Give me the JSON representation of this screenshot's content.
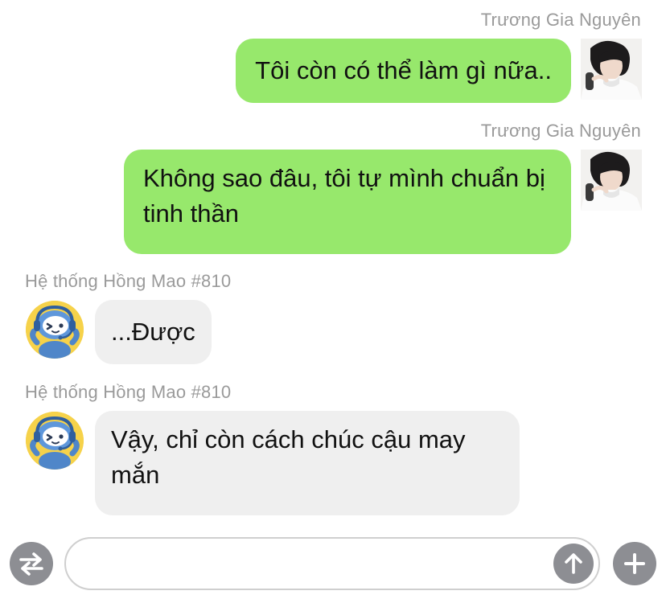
{
  "messages": [
    {
      "sender": "Trương Gia Nguyên",
      "text": "Tôi còn có thể làm gì nữa..",
      "direction": "outgoing",
      "avatar": "user-photo-avatar"
    },
    {
      "sender": "Trương Gia Nguyên",
      "text": "Không sao đâu, tôi tự mình chuẩn bị tinh thần",
      "direction": "outgoing",
      "avatar": "user-photo-avatar"
    },
    {
      "sender": "Hệ thống Hồng Mao #810",
      "text": "...Được",
      "direction": "incoming",
      "avatar": "robot-headset-avatar"
    },
    {
      "sender": "Hệ thống Hồng Mao #810",
      "text": "Vậy, chỉ còn cách chúc cậu may mắn",
      "direction": "incoming",
      "avatar": "robot-headset-avatar"
    }
  ],
  "composer": {
    "input_value": "",
    "input_placeholder": "",
    "left_icon": "swap-arrows-icon",
    "send_icon": "arrow-up-icon",
    "right_icon": "plus-icon"
  },
  "colors": {
    "outgoing_bubble": "#97e86c",
    "incoming_bubble": "#efefef",
    "sender_name": "#9a9a9a",
    "icon_button": "#8d8e93"
  }
}
